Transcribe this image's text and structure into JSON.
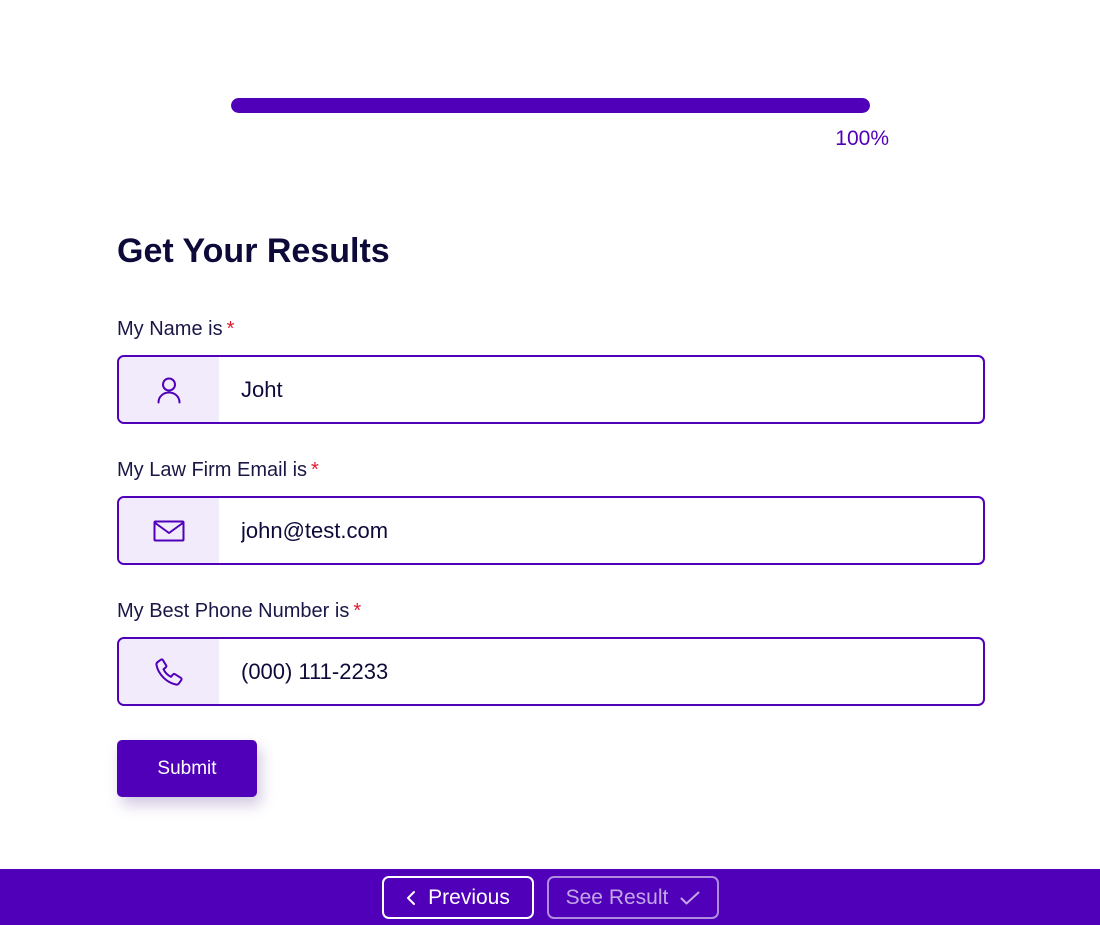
{
  "progress": {
    "percent": 100,
    "label": "100%"
  },
  "form": {
    "title": "Get Your Results",
    "fields": [
      {
        "label": "My Name is",
        "required_mark": "*",
        "icon": "user-icon",
        "value": "Joht"
      },
      {
        "label": "My Law Firm Email is",
        "required_mark": "*",
        "icon": "mail-icon",
        "value": "john@test.com"
      },
      {
        "label": "My Best Phone Number is",
        "required_mark": "*",
        "icon": "phone-icon",
        "value": "(000) 111-2233"
      }
    ],
    "submit_label": "Submit"
  },
  "footer": {
    "previous_label": "Previous",
    "previous_icon": "chevron-left-icon",
    "see_result_label": "See Result",
    "see_result_icon": "check-icon"
  },
  "colors": {
    "accent": "#5000b9",
    "icon_bg": "#f2ebfb",
    "required": "#e0182d",
    "title": "#0d0a3a"
  }
}
